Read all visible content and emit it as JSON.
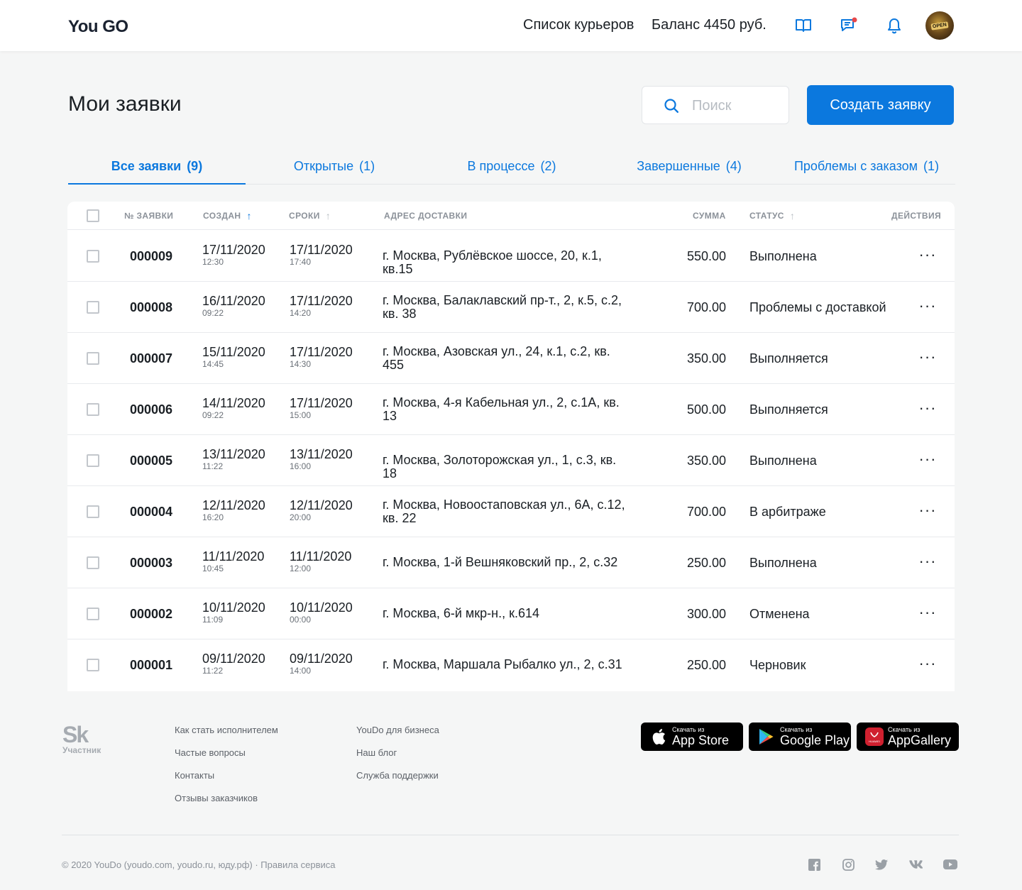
{
  "header": {
    "logo": "You GO",
    "couriers_link": "Список курьеров",
    "balance": "Баланс 4450 руб.",
    "avatar_text": "OPEN"
  },
  "page": {
    "title": "Мои заявки",
    "search_placeholder": "Поиск",
    "create_button": "Создать заявку"
  },
  "tabs": [
    {
      "label": "Все заявки",
      "count": "(9)",
      "active": true
    },
    {
      "label": "Открытые",
      "count": "(1)",
      "active": false
    },
    {
      "label": "В процессе",
      "count": "(2)",
      "active": false
    },
    {
      "label": "Завершенные",
      "count": "(4)",
      "active": false
    },
    {
      "label": "Проблемы с заказом",
      "count": "(1)",
      "active": false
    }
  ],
  "table": {
    "columns": {
      "number": "№ ЗАЯВКИ",
      "created": "СОЗДАН",
      "deadline": "СРОКИ",
      "address": "АДРЕС ДОСТАВКИ",
      "sum": "СУММА",
      "status": "СТАТУС",
      "actions": "ДЕЙСТВИЯ"
    },
    "rows": [
      {
        "number": "000009",
        "created_date": "17/11/2020",
        "created_time": "12:30",
        "due_date": "17/11/2020",
        "due_time": "17:40",
        "address": "г. Москва, Рублёвское шоссе, 20, к.1, кв.15",
        "sum": "550.00",
        "status": "Выполнена"
      },
      {
        "number": "000008",
        "created_date": "16/11/2020",
        "created_time": "09:22",
        "due_date": "17/11/2020",
        "due_time": "14:20",
        "address": "г. Москва, Балаклавский пр-т., 2, к.5, с.2, кв. 38",
        "sum": "700.00",
        "status": "Проблемы с доставкой"
      },
      {
        "number": "000007",
        "created_date": "15/11/2020",
        "created_time": "14:45",
        "due_date": "17/11/2020",
        "due_time": "14:30",
        "address": "г. Москва, Азовская ул., 24, к.1, с.2, кв. 455",
        "sum": "350.00",
        "status": "Выполняется"
      },
      {
        "number": "000006",
        "created_date": "14/11/2020",
        "created_time": "09:22",
        "due_date": "17/11/2020",
        "due_time": "15:00",
        "address": "г. Москва, 4-я Кабельная ул., 2, с.1А, кв. 13",
        "sum": "500.00",
        "status": "Выполняется"
      },
      {
        "number": "000005",
        "created_date": "13/11/2020",
        "created_time": "11:22",
        "due_date": "13/11/2020",
        "due_time": "16:00",
        "address": "г. Москва, Золоторожская ул., 1, с.3, кв. 18",
        "sum": "350.00",
        "status": "Выполнена"
      },
      {
        "number": "000004",
        "created_date": "12/11/2020",
        "created_time": "16:20",
        "due_date": "12/11/2020",
        "due_time": "20:00",
        "address": "г. Москва, Новоостаповская ул., 6А, с.12, кв. 22",
        "sum": "700.00",
        "status": "В арбитраже"
      },
      {
        "number": "000003",
        "created_date": "11/11/2020",
        "created_time": "10:45",
        "due_date": "11/11/2020",
        "due_time": "12:00",
        "address": "г. Москва, 1-й Вешняковский пр., 2, с.32",
        "sum": "250.00",
        "status": "Выполнена"
      },
      {
        "number": "000002",
        "created_date": "10/11/2020",
        "created_time": "11:09",
        "due_date": "10/11/2020",
        "due_time": "00:00",
        "address": "г. Москва, 6-й мкр-н., к.614",
        "sum": "300.00",
        "status": "Отменена"
      },
      {
        "number": "000001",
        "created_date": "09/11/2020",
        "created_time": "11:22",
        "due_date": "09/11/2020",
        "due_time": "14:00",
        "address": "г. Москва, Маршала Рыбалко ул., 2, с.31",
        "sum": "250.00",
        "status": "Черновик"
      }
    ],
    "actions_glyph": "···"
  },
  "footer": {
    "sk_logo": "Sk",
    "sk_caption": "Участник",
    "links_col1": [
      "Как стать исполнителем",
      "Частые вопросы",
      "Контакты",
      "Отзывы заказчиков"
    ],
    "links_col2": [
      "YouDo для бизнеса",
      "Наш блог",
      "Служба поддержки"
    ],
    "stores": [
      {
        "small": "Скачать из",
        "big": "App Store",
        "icon": "apple-icon"
      },
      {
        "small": "Скачать из",
        "big": "Google Play",
        "icon": "google-play-icon"
      },
      {
        "small": "Скачать из",
        "big": "AppGallery",
        "icon": "huawei-icon"
      }
    ],
    "huawei_badge": "HUAWEI",
    "copyright": "© 2020 YouDo (youdo.com, youdo.ru, юду.рф) · Правила сервиса",
    "social": [
      "facebook-icon",
      "instagram-icon",
      "twitter-icon",
      "vk-icon",
      "youtube-icon"
    ]
  },
  "colors": {
    "accent": "#0b78de",
    "background": "#f5f6f6",
    "notification_dot": "#e8484a"
  }
}
